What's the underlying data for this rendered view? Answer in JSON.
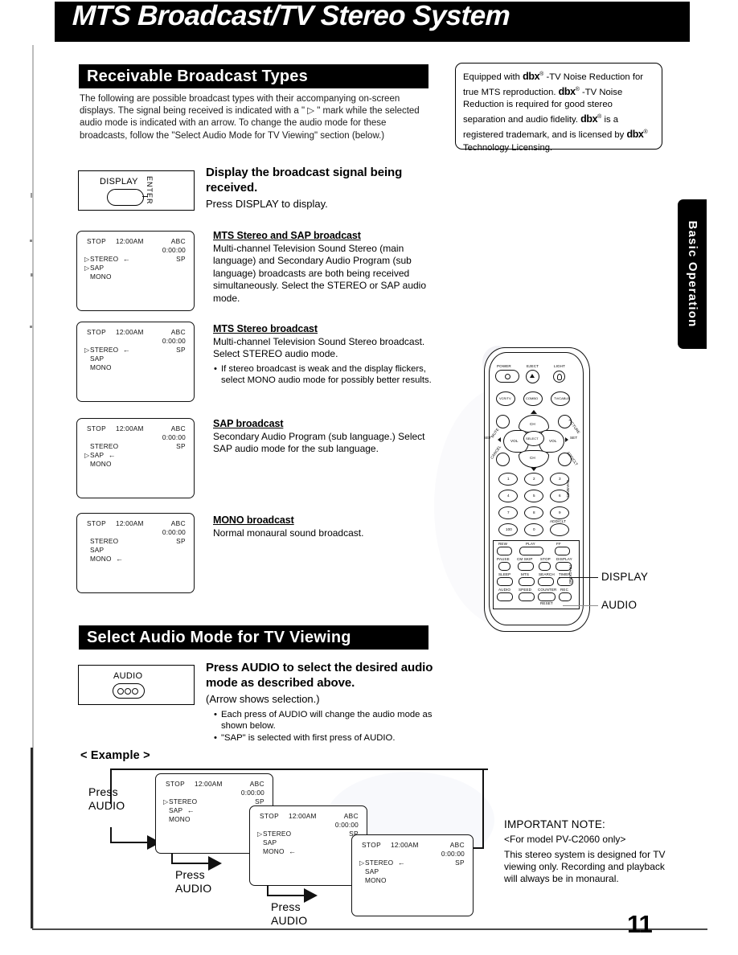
{
  "masthead": {
    "title": "MTS Broadcast/TV Stereo System"
  },
  "side_tab": {
    "label": "Basic Operation"
  },
  "page_number": "11",
  "sections": {
    "receivable": {
      "bar_title": "Receivable Broadcast Types",
      "intro": "The following are possible broadcast types with their accompanying on-screen displays. The signal being received is indicated with a \" ▷ \" mark while the selected audio mode is indicated with an arrow. To change the audio mode for these broadcasts, follow the \"Select Audio Mode for TV Viewing\" section (below.)",
      "key_box": {
        "label": "DISPLAY",
        "sub_label": "ENTER"
      },
      "instruction_bold": "Display the broadcast signal being received.",
      "instruction_plain": "Press DISPLAY to display."
    },
    "select_audio": {
      "bar_title": "Select Audio Mode for TV Viewing",
      "key_box": {
        "label": "AUDIO"
      },
      "instruction_bold": "Press AUDIO to select the desired audio mode as described above.",
      "instruction_plain": "(Arrow shows selection.)",
      "bullets": [
        "Each press of AUDIO will change the audio mode as shown below.",
        "\"SAP\" is selected with first press of AUDIO."
      ]
    }
  },
  "dbx_note": {
    "line1_a": "Equipped with ",
    "line1_mark": "dbx",
    "line1_b": " -TV Noise Reduction for true MTS reproduction.",
    "line2_mark": "dbx",
    "line2_b": " -TV Noise Reduction is required for good stereo separation and audio fidelity.",
    "line3_mark": "dbx",
    "line3_b": " is a registered trademark, and is licensed by ",
    "line3_mark2": "dbx",
    "line3_c": " Technology Licensing."
  },
  "broadcast_types": [
    {
      "heading": "MTS Stereo and SAP broadcast",
      "body": "Multi-channel Television Sound Stereo (main language) and Secondary Audio Program (sub language) broadcasts are both being received simultaneously. Select the STEREO or SAP audio mode.",
      "bullet": "",
      "osd": {
        "status": "STOP",
        "clock": "12:00AM",
        "channel": "ABC",
        "counter": "0:00:00",
        "speed": "SP",
        "modes": [
          {
            "label": "STEREO",
            "signal": true,
            "selected": true
          },
          {
            "label": "SAP",
            "signal": true,
            "selected": false
          },
          {
            "label": "MONO",
            "signal": false,
            "selected": false
          }
        ]
      }
    },
    {
      "heading": "MTS Stereo broadcast",
      "body": "Multi-channel Television Sound Stereo broadcast. Select STEREO audio mode.",
      "bullet": "If stereo broadcast is weak and the display flickers, select MONO audio mode for possibly better results.",
      "osd": {
        "status": "STOP",
        "clock": "12:00AM",
        "channel": "ABC",
        "counter": "0:00:00",
        "speed": "SP",
        "modes": [
          {
            "label": "STEREO",
            "signal": true,
            "selected": true
          },
          {
            "label": "SAP",
            "signal": false,
            "selected": false
          },
          {
            "label": "MONO",
            "signal": false,
            "selected": false
          }
        ]
      }
    },
    {
      "heading": "SAP broadcast",
      "body": "Secondary Audio Program (sub language.) Select SAP audio mode for the sub language.",
      "bullet": "",
      "osd": {
        "status": "STOP",
        "clock": "12:00AM",
        "channel": "ABC",
        "counter": "0:00:00",
        "speed": "SP",
        "modes": [
          {
            "label": "STEREO",
            "signal": false,
            "selected": false
          },
          {
            "label": "SAP",
            "signal": true,
            "selected": true
          },
          {
            "label": "MONO",
            "signal": false,
            "selected": false
          }
        ]
      }
    },
    {
      "heading": "MONO broadcast",
      "body": "Normal monaural sound broadcast.",
      "bullet": "",
      "osd": {
        "status": "STOP",
        "clock": "12:00AM",
        "channel": "ABC",
        "counter": "0:00:00",
        "speed": "SP",
        "modes": [
          {
            "label": "STEREO",
            "signal": false,
            "selected": false
          },
          {
            "label": "SAP",
            "signal": false,
            "selected": false
          },
          {
            "label": "MONO",
            "signal": false,
            "selected": true
          }
        ]
      }
    }
  ],
  "example": {
    "label": "< Example >",
    "press_label": "Press\nAUDIO",
    "steps": [
      {
        "osd": {
          "status": "STOP",
          "clock": "12:00AM",
          "channel": "ABC",
          "counter": "0:00:00",
          "speed": "SP",
          "modes": [
            {
              "label": "STEREO",
              "signal": true,
              "selected": false
            },
            {
              "label": "SAP",
              "signal": false,
              "selected": true
            },
            {
              "label": "MONO",
              "signal": false,
              "selected": false
            }
          ]
        }
      },
      {
        "osd": {
          "status": "STOP",
          "clock": "12:00AM",
          "channel": "ABC",
          "counter": "0:00:00",
          "speed": "SP",
          "modes": [
            {
              "label": "STEREO",
              "signal": true,
              "selected": false
            },
            {
              "label": "SAP",
              "signal": false,
              "selected": false
            },
            {
              "label": "MONO",
              "signal": false,
              "selected": true
            }
          ]
        }
      },
      {
        "osd": {
          "status": "STOP",
          "clock": "12:00AM",
          "channel": "ABC",
          "counter": "0:00:00",
          "speed": "SP",
          "modes": [
            {
              "label": "STEREO",
              "signal": true,
              "selected": true
            },
            {
              "label": "SAP",
              "signal": false,
              "selected": false
            },
            {
              "label": "MONO",
              "signal": false,
              "selected": false
            }
          ]
        }
      }
    ]
  },
  "callouts": [
    {
      "label": "DISPLAY"
    },
    {
      "label": "AUDIO"
    }
  ],
  "important_note": {
    "title": "IMPORTANT NOTE:",
    "model": "<For model PV-C2060 only>",
    "body": "This stereo system is designed for TV viewing only. Recording and playback will always be in monaural."
  },
  "remote": {
    "labels_top": [
      "POWER",
      "EJECT",
      "LIGHT"
    ],
    "labels_mode": [
      "VCR/TV",
      "COMBO",
      "TV/CABLE"
    ],
    "labels_dpad": [
      "CH",
      "VOL",
      "SELECT",
      "CH",
      "VOL",
      "SET",
      "SET",
      "MUTE",
      "PICTURE",
      "CANCEL",
      "ADD/DLT"
    ],
    "numbers": [
      "1",
      "2",
      "3",
      "4",
      "5",
      "6",
      "7",
      "8",
      "9",
      "100",
      "0"
    ],
    "label_addclt": "ADD/CLT",
    "labels_transport": [
      "REW",
      "PLAY",
      "FF"
    ],
    "labels_row2": [
      "PAUSE",
      "CM SKIP",
      "STOP",
      "DISPLAY"
    ],
    "labels_row3": [
      "SLEEP",
      "MTS",
      "SEARCH",
      "TIMER"
    ],
    "labels_row4": [
      "AUDIO",
      "SPEED",
      "COUNTER",
      "REC"
    ],
    "label_reset": "RESET",
    "label_side": "CHANNEL",
    "label_side2": "TRACKING"
  }
}
